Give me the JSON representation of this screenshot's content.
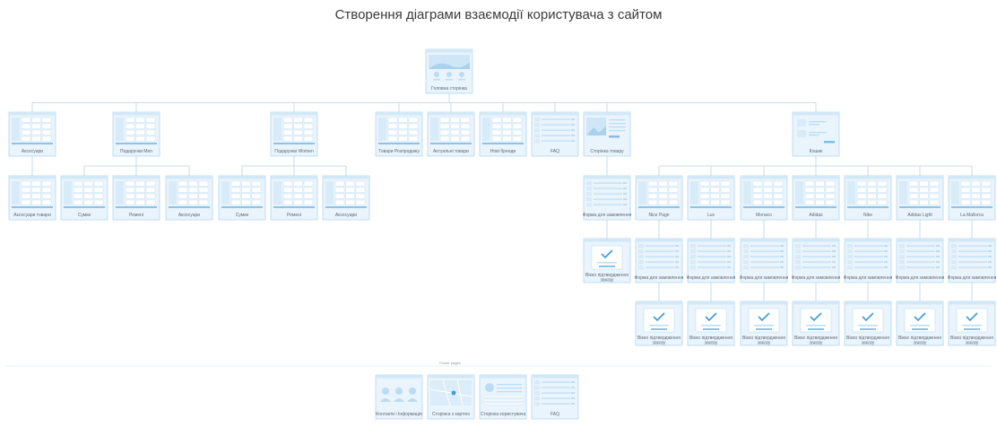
{
  "title": "Створення діаграми взаємодії користувача з сайтом",
  "separator_label": "Footer pages",
  "colors": {
    "card_fill": "#eaf4fc",
    "card_border": "#a9d2ef",
    "header_strip": "#d3e8f7",
    "accent": "#3d9ad8",
    "line": "#b7d3ea",
    "text": "#5b6a77"
  },
  "nodes": [
    {
      "id": "home",
      "label": "Головна сторінка",
      "type": "hero",
      "parent": null
    },
    {
      "id": "accessories",
      "label": "Аксесуари",
      "type": "product",
      "parent": "home"
    },
    {
      "id": "for_men",
      "label": "Подарунки Men",
      "type": "product",
      "parent": "home"
    },
    {
      "id": "for_women",
      "label": "Подарунки Women",
      "type": "product",
      "parent": "home"
    },
    {
      "id": "sale",
      "label": "Товари Розпродажу",
      "type": "product",
      "parent": "home"
    },
    {
      "id": "new",
      "label": "Актуальні товари",
      "type": "product",
      "parent": "home"
    },
    {
      "id": "brands",
      "label": "Нові бренди",
      "type": "product",
      "parent": "home"
    },
    {
      "id": "faq_top",
      "label": "FAQ",
      "type": "form",
      "parent": "home"
    },
    {
      "id": "product_page",
      "label": "Сторінка товару",
      "type": "detail",
      "parent": "home"
    },
    {
      "id": "cart_root",
      "label": "Кошик",
      "type": "cart",
      "parent": "home"
    },
    {
      "id": "acc_all",
      "label": "Аксесуари товари",
      "type": "product",
      "parent": "accessories"
    },
    {
      "id": "men_bags",
      "label": "Сумки",
      "type": "product",
      "parent": "for_men"
    },
    {
      "id": "men_belts",
      "label": "Ремені",
      "type": "product",
      "parent": "for_men"
    },
    {
      "id": "men_acc",
      "label": "Аксесуари",
      "type": "product",
      "parent": "for_men"
    },
    {
      "id": "women_bags",
      "label": "Сумки",
      "type": "product",
      "parent": "for_women"
    },
    {
      "id": "women_belts",
      "label": "Ремені",
      "type": "product",
      "parent": "for_women"
    },
    {
      "id": "women_acc",
      "label": "Аксесуари",
      "type": "product",
      "parent": "for_women"
    },
    {
      "id": "order_form",
      "label": "Форма для замовлення",
      "type": "list",
      "parent": "product_page"
    },
    {
      "id": "order_ok",
      "label": "Вікно підтвердження заказу",
      "type": "confirm",
      "parent": "order_form"
    },
    {
      "id": "b1",
      "label": "Nice Page",
      "type": "product",
      "parent": "cart_root"
    },
    {
      "id": "b2",
      "label": "Lux",
      "type": "product",
      "parent": "cart_root"
    },
    {
      "id": "b3",
      "label": "Monaco",
      "type": "product",
      "parent": "cart_root"
    },
    {
      "id": "b4",
      "label": "Adidas",
      "type": "product",
      "parent": "cart_root"
    },
    {
      "id": "b5",
      "label": "Nike",
      "type": "product",
      "parent": "cart_root"
    },
    {
      "id": "b6",
      "label": "Adidas Light",
      "type": "product",
      "parent": "cart_root"
    },
    {
      "id": "b7",
      "label": "La Mallorca",
      "type": "product",
      "parent": "cart_root"
    },
    {
      "id": "f1",
      "label": "Форма для замовлення",
      "type": "list",
      "parent": "b1"
    },
    {
      "id": "f2",
      "label": "Форма для замовлення",
      "type": "list",
      "parent": "b2"
    },
    {
      "id": "f3",
      "label": "Форма для замовлення",
      "type": "list",
      "parent": "b3"
    },
    {
      "id": "f4",
      "label": "Форма для замовлення",
      "type": "list",
      "parent": "b4"
    },
    {
      "id": "f5",
      "label": "Форма для замовлення",
      "type": "list",
      "parent": "b5"
    },
    {
      "id": "f6",
      "label": "Форма для замовлення",
      "type": "list",
      "parent": "b6"
    },
    {
      "id": "f7",
      "label": "Форма для замовлення",
      "type": "list",
      "parent": "b7"
    },
    {
      "id": "c1",
      "label": "Вікно підтвердження заказу",
      "type": "confirm",
      "parent": "f1"
    },
    {
      "id": "c2",
      "label": "Вікно підтвердження заказу",
      "type": "confirm",
      "parent": "f2"
    },
    {
      "id": "c3",
      "label": "Вікно підтвердження заказу",
      "type": "confirm",
      "parent": "f3"
    },
    {
      "id": "c4",
      "label": "Вікно підтвердження заказу",
      "type": "confirm",
      "parent": "f4"
    },
    {
      "id": "c5",
      "label": "Вікно підтвердження заказу",
      "type": "confirm",
      "parent": "f5"
    },
    {
      "id": "c6",
      "label": "Вікно підтвердження заказу",
      "type": "confirm",
      "parent": "f6"
    },
    {
      "id": "c7",
      "label": "Вікно підтвердження заказу",
      "type": "confirm",
      "parent": "f7"
    },
    {
      "id": "foot_about",
      "label": "Контакти і Інформація",
      "type": "team",
      "parent": null
    },
    {
      "id": "foot_map",
      "label": "Сторінка з картою",
      "type": "map",
      "parent": null
    },
    {
      "id": "foot_profile",
      "label": "Сторінка користувача",
      "type": "profile",
      "parent": null
    },
    {
      "id": "foot_faq",
      "label": "FAQ",
      "type": "form",
      "parent": null
    }
  ]
}
